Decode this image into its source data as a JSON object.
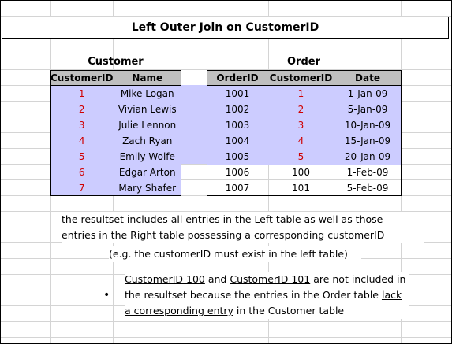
{
  "title": "Left Outer Join on CustomerID",
  "customer_table": {
    "caption": "Customer",
    "headers": [
      "CustomerID",
      "Name"
    ],
    "rows": [
      {
        "id": "1",
        "name": "Mike Logan"
      },
      {
        "id": "2",
        "name": "Vivian Lewis"
      },
      {
        "id": "3",
        "name": "Julie Lennon"
      },
      {
        "id": "4",
        "name": "Zach Ryan"
      },
      {
        "id": "5",
        "name": "Emily Wolfe"
      },
      {
        "id": "6",
        "name": "Edgar Arton"
      },
      {
        "id": "7",
        "name": "Mary Shafer"
      }
    ]
  },
  "order_table": {
    "caption": "Order",
    "headers": [
      "OrderID",
      "CustomerID",
      "Date"
    ],
    "rows": [
      {
        "order_id": "1001",
        "customer_id": "1",
        "date": "1-Jan-09"
      },
      {
        "order_id": "1002",
        "customer_id": "2",
        "date": "5-Jan-09"
      },
      {
        "order_id": "1003",
        "customer_id": "3",
        "date": "10-Jan-09"
      },
      {
        "order_id": "1004",
        "customer_id": "4",
        "date": "15-Jan-09"
      },
      {
        "order_id": "1005",
        "customer_id": "5",
        "date": "20-Jan-09"
      },
      {
        "order_id": "1006",
        "customer_id": "100",
        "date": "1-Feb-09"
      },
      {
        "order_id": "1007",
        "customer_id": "101",
        "date": "5-Feb-09"
      }
    ]
  },
  "note": {
    "line1": "the resultset includes all entries in the Left table as well as those",
    "line2": "entries in the Right table possessing a corresponding customerID",
    "line3": "(e.g. the customerID must exist in the left table)"
  },
  "bullet": {
    "symbol": "•",
    "p1": "CustomerID 100",
    "p2": " and ",
    "p3": "CustomerID 101",
    "p4": " are not included in",
    "p5": "the resultset because the entries in the Order table ",
    "p6": "lack",
    "p7": "a corresponding entry",
    "p8": " in the Customer table"
  },
  "colors": {
    "match_fill": "#ccccff",
    "header_fill": "#bfbfbf",
    "id_red": "#d00000"
  }
}
